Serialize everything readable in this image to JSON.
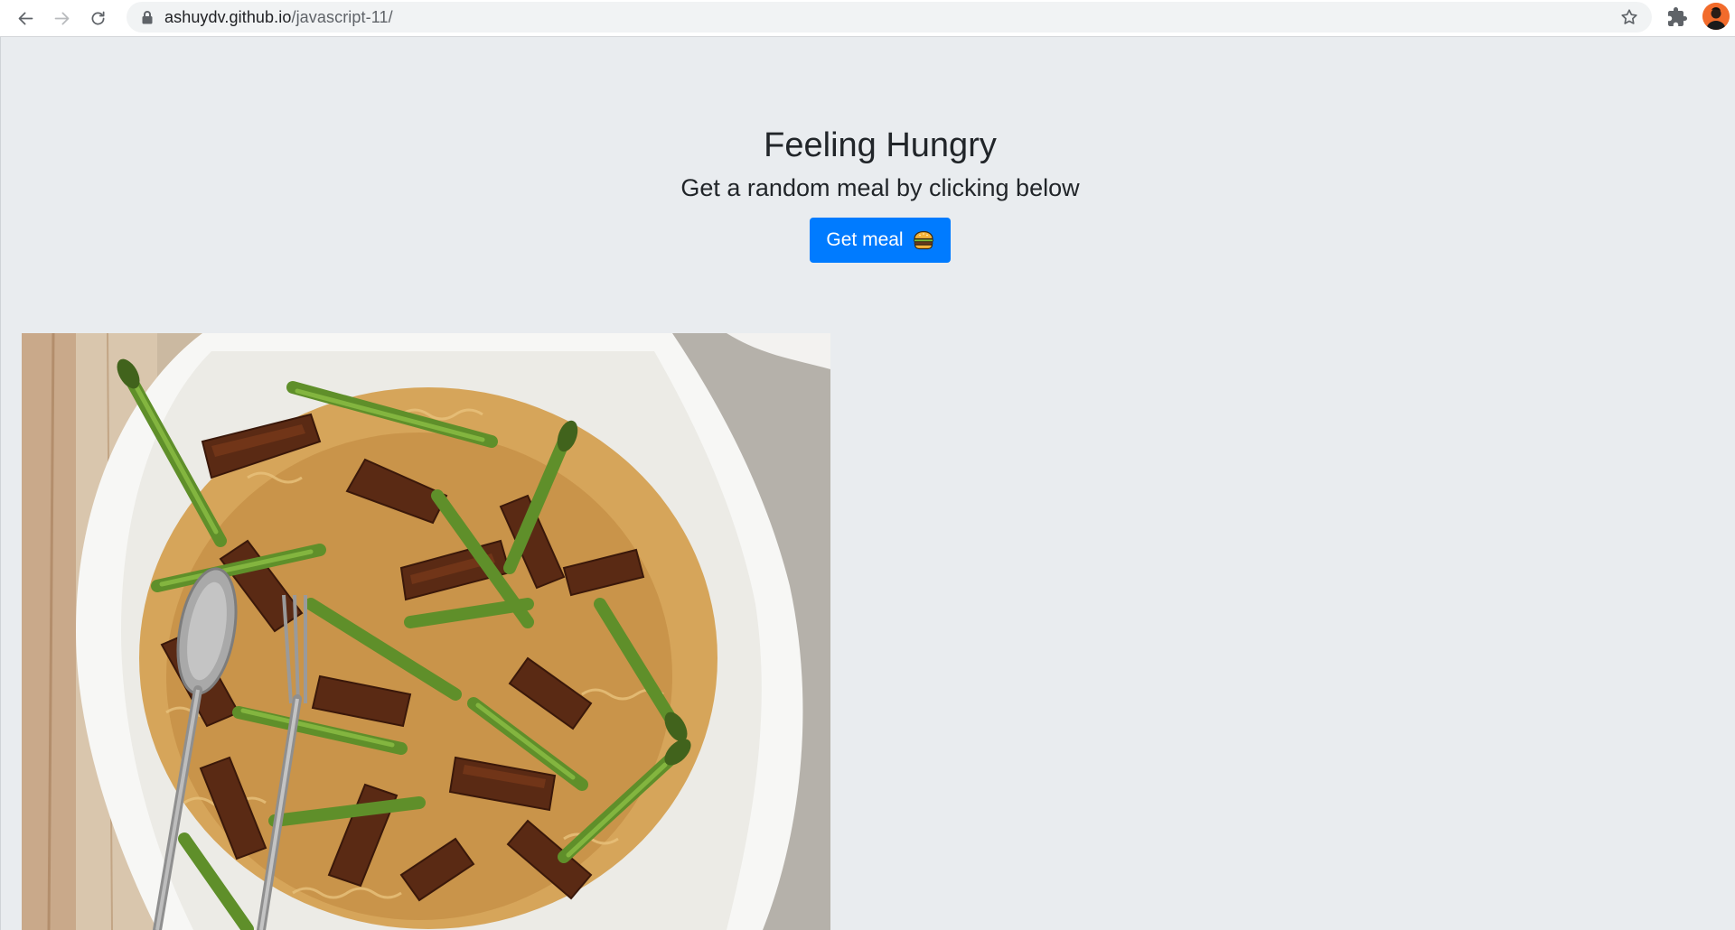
{
  "browser": {
    "url_host": "ashuydv.github.io",
    "url_path": "/javascript-11/",
    "icons": [
      "back-arrow-icon",
      "forward-arrow-icon",
      "reload-icon",
      "lock-icon",
      "star-icon",
      "extensions-icon",
      "avatar"
    ]
  },
  "hero": {
    "title": "Feeling Hungry",
    "subtitle": "Get a random meal by clicking below",
    "button_label": "Get meal",
    "button_icon": "burger-emoji-icon",
    "button_color": "#007bff"
  },
  "colors": {
    "page_background": "#e9ecef",
    "text": "#212529"
  }
}
